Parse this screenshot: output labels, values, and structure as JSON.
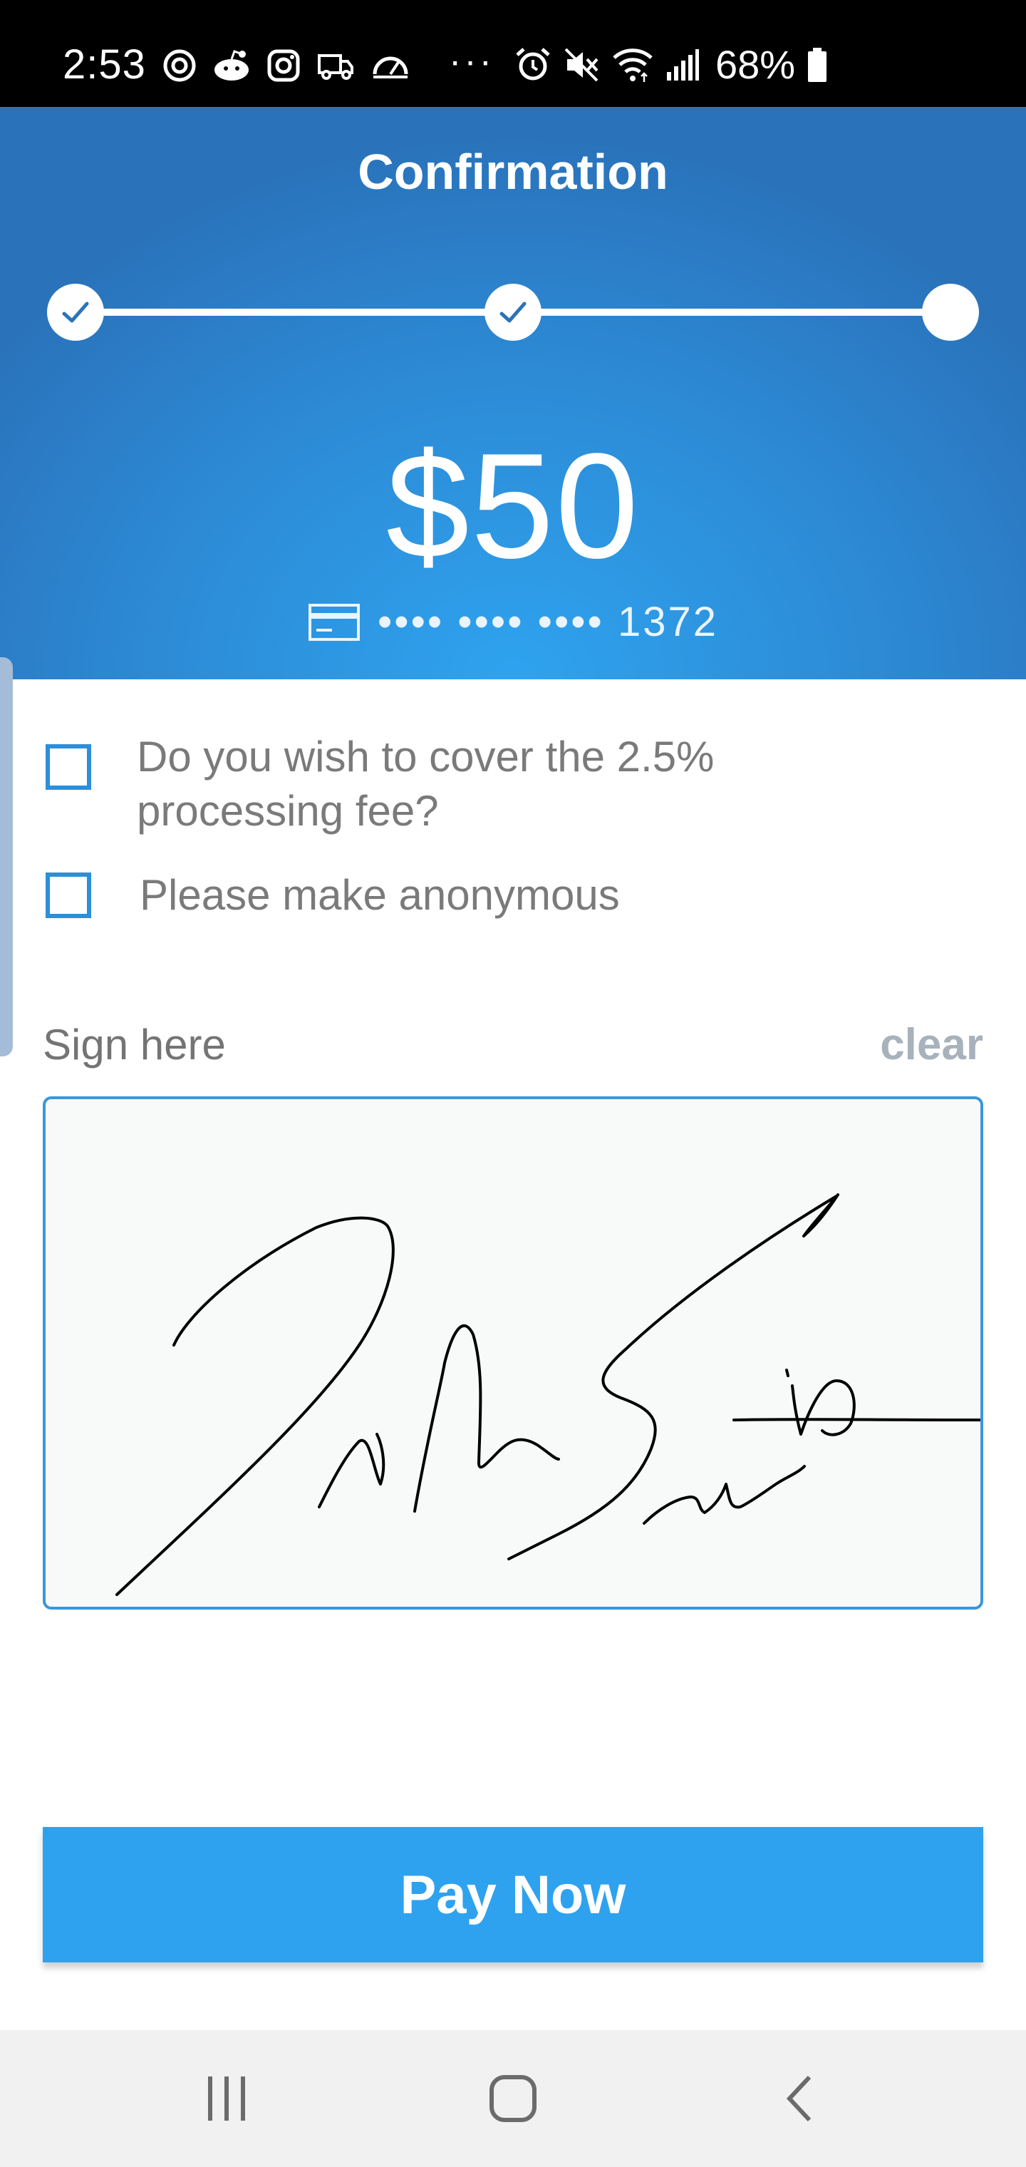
{
  "status_bar": {
    "time": "2:53",
    "overflow": "···",
    "battery": "68%",
    "left_icons": [
      "threads-icon",
      "reddit-icon",
      "instagram-icon",
      "delivery-truck-icon",
      "speedometer-icon"
    ],
    "right_icons": [
      "alarm-icon",
      "mute-icon",
      "wifi-icon",
      "signal-icon",
      "battery-icon"
    ]
  },
  "header": {
    "title": "Confirmation",
    "steps": [
      {
        "state": "complete",
        "icon": "check-icon"
      },
      {
        "state": "complete",
        "icon": "check-icon"
      },
      {
        "state": "current"
      }
    ],
    "amount": "$50",
    "card": {
      "icon": "credit-card-icon",
      "masked": "•••• •••• •••• 1372"
    }
  },
  "options": {
    "cover_fee": {
      "label": "Do you wish to cover the 2.5% processing fee?",
      "checked": false
    },
    "anonymous": {
      "label": "Please make anonymous",
      "checked": false
    }
  },
  "signature": {
    "label": "Sign here",
    "clear_label": "clear"
  },
  "pay_button": {
    "label": "Pay Now"
  },
  "nav_bar": {
    "icons": [
      "recent-apps-icon",
      "home-icon",
      "back-icon"
    ]
  },
  "colors": {
    "header_top": "#2a73bb",
    "header_center": "#2ea3ef",
    "accent": "#2ea2ee",
    "checkbox_border": "#2c8fd8",
    "text_gray": "#7a7a7a",
    "clear_gray": "#a8b2bc",
    "nav_bg": "#f1f1f1"
  }
}
